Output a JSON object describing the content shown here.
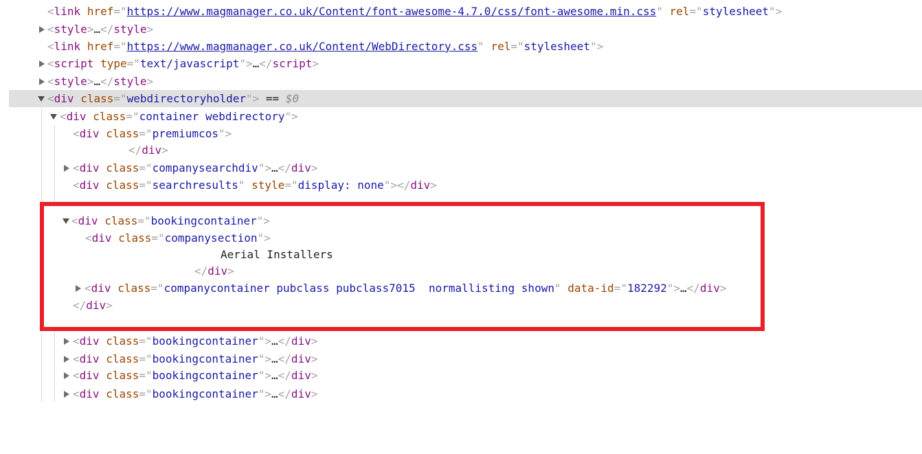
{
  "rows": [
    {
      "parts": [
        [
          "br",
          "<"
        ],
        [
          "tag",
          "link"
        ],
        [
          "txt",
          " "
        ],
        [
          "attr",
          "href"
        ],
        [
          "br",
          "=\""
        ],
        [
          "link",
          "https://www.magmanager.co.uk/Content/font-awesome-4.7.0/css/font-awesome.min.css"
        ],
        [
          "br",
          "\""
        ],
        [
          "txt",
          " "
        ],
        [
          "attr",
          "rel"
        ],
        [
          "br",
          "=\""
        ],
        [
          "val",
          "stylesheet"
        ],
        [
          "br",
          "\">"
        ]
      ]
    },
    {
      "parts": [
        [
          "br",
          "<"
        ],
        [
          "tag",
          "style"
        ],
        [
          "br",
          ">"
        ],
        [
          "ell",
          "…"
        ],
        [
          "br",
          "</"
        ],
        [
          "tag",
          "style"
        ],
        [
          "br",
          ">"
        ]
      ]
    },
    {
      "parts": [
        [
          "br",
          "<"
        ],
        [
          "tag",
          "link"
        ],
        [
          "txt",
          " "
        ],
        [
          "attr",
          "href"
        ],
        [
          "br",
          "=\""
        ],
        [
          "link",
          "https://www.magmanager.co.uk/Content/WebDirectory.css"
        ],
        [
          "br",
          "\""
        ],
        [
          "txt",
          " "
        ],
        [
          "attr",
          "rel"
        ],
        [
          "br",
          "=\""
        ],
        [
          "val",
          "stylesheet"
        ],
        [
          "br",
          "\">"
        ]
      ]
    },
    {
      "parts": [
        [
          "br",
          "<"
        ],
        [
          "tag",
          "script"
        ],
        [
          "txt",
          " "
        ],
        [
          "attr",
          "type"
        ],
        [
          "br",
          "=\""
        ],
        [
          "val",
          "text/javascript"
        ],
        [
          "br",
          "\">"
        ],
        [
          "ell",
          "…"
        ],
        [
          "br",
          "</"
        ],
        [
          "tag",
          "script"
        ],
        [
          "br",
          ">"
        ]
      ]
    },
    {
      "parts": [
        [
          "br",
          "<"
        ],
        [
          "tag",
          "style"
        ],
        [
          "br",
          ">"
        ],
        [
          "ell",
          "…"
        ],
        [
          "br",
          "</"
        ],
        [
          "tag",
          "style"
        ],
        [
          "br",
          ">"
        ]
      ]
    },
    {
      "parts": [
        [
          "br",
          "<"
        ],
        [
          "tag",
          "div"
        ],
        [
          "txt",
          " "
        ],
        [
          "attr",
          "class"
        ],
        [
          "br",
          "=\""
        ],
        [
          "val",
          "webdirectoryholder"
        ],
        [
          "br",
          "\">"
        ],
        [
          "eq",
          " == "
        ],
        [
          "dollar",
          "$0"
        ]
      ]
    },
    {
      "parts": [
        [
          "br",
          "<"
        ],
        [
          "tag",
          "div"
        ],
        [
          "txt",
          " "
        ],
        [
          "attr",
          "class"
        ],
        [
          "br",
          "=\""
        ],
        [
          "val",
          "container webdirectory"
        ],
        [
          "br",
          "\">"
        ]
      ]
    },
    {
      "parts": [
        [
          "br",
          "<"
        ],
        [
          "tag",
          "div"
        ],
        [
          "txt",
          " "
        ],
        [
          "attr",
          "class"
        ],
        [
          "br",
          "=\""
        ],
        [
          "val",
          "premiumcos"
        ],
        [
          "br",
          "\">"
        ]
      ]
    },
    {
      "parts": [
        [
          "br",
          "</"
        ],
        [
          "tag",
          "div"
        ],
        [
          "br",
          ">"
        ]
      ]
    },
    {
      "parts": [
        [
          "br",
          "<"
        ],
        [
          "tag",
          "div"
        ],
        [
          "txt",
          " "
        ],
        [
          "attr",
          "class"
        ],
        [
          "br",
          "=\""
        ],
        [
          "val",
          "companysearchdiv"
        ],
        [
          "br",
          "\">"
        ],
        [
          "ell",
          "…"
        ],
        [
          "br",
          "</"
        ],
        [
          "tag",
          "div"
        ],
        [
          "br",
          ">"
        ]
      ]
    },
    {
      "parts": [
        [
          "br",
          "<"
        ],
        [
          "tag",
          "div"
        ],
        [
          "txt",
          " "
        ],
        [
          "attr",
          "class"
        ],
        [
          "br",
          "=\""
        ],
        [
          "val",
          "searchresults"
        ],
        [
          "br",
          "\""
        ],
        [
          "txt",
          " "
        ],
        [
          "attr",
          "style"
        ],
        [
          "br",
          "=\""
        ],
        [
          "val",
          "display: none"
        ],
        [
          "br",
          "\"></"
        ],
        [
          "tag",
          "div"
        ],
        [
          "br",
          ">"
        ]
      ]
    },
    {
      "parts": [
        [
          "br",
          "<"
        ],
        [
          "tag",
          "div"
        ],
        [
          "txt",
          " "
        ],
        [
          "attr",
          "class"
        ],
        [
          "br",
          "=\""
        ],
        [
          "val",
          "bookingcontainer"
        ],
        [
          "br",
          "\">"
        ]
      ]
    },
    {
      "parts": [
        [
          "br",
          "<"
        ],
        [
          "tag",
          "div"
        ],
        [
          "txt",
          " "
        ],
        [
          "attr",
          "class"
        ],
        [
          "br",
          "=\""
        ],
        [
          "val",
          "companysection"
        ],
        [
          "br",
          "\">"
        ]
      ]
    },
    {
      "parts": [
        [
          "txt",
          "Aerial Installers"
        ]
      ]
    },
    {
      "parts": [
        [
          "br",
          "</"
        ],
        [
          "tag",
          "div"
        ],
        [
          "br",
          ">"
        ]
      ]
    },
    {
      "parts": [
        [
          "br",
          "<"
        ],
        [
          "tag",
          "div"
        ],
        [
          "txt",
          " "
        ],
        [
          "attr",
          "class"
        ],
        [
          "br",
          "=\""
        ],
        [
          "val",
          "companycontainer pubclass pubclass7015  normallisting shown"
        ],
        [
          "br",
          "\""
        ],
        [
          "txt",
          " "
        ],
        [
          "attr",
          "data-id"
        ],
        [
          "br",
          "=\""
        ],
        [
          "val",
          "182292"
        ],
        [
          "br",
          "\">"
        ],
        [
          "ell",
          "…"
        ],
        [
          "br",
          "</"
        ],
        [
          "tag",
          "div"
        ],
        [
          "br",
          ">"
        ]
      ]
    },
    {
      "parts": [
        [
          "br",
          "</"
        ],
        [
          "tag",
          "div"
        ],
        [
          "br",
          ">"
        ]
      ]
    },
    {
      "parts": [
        [
          "br",
          "<"
        ],
        [
          "tag",
          "div"
        ],
        [
          "txt",
          " "
        ],
        [
          "attr",
          "class"
        ],
        [
          "br",
          "=\""
        ],
        [
          "val",
          "bookingcontainer"
        ],
        [
          "br",
          "\">"
        ],
        [
          "ell",
          "…"
        ],
        [
          "br",
          "</"
        ],
        [
          "tag",
          "div"
        ],
        [
          "br",
          ">"
        ]
      ]
    },
    {
      "parts": [
        [
          "br",
          "<"
        ],
        [
          "tag",
          "div"
        ],
        [
          "txt",
          " "
        ],
        [
          "attr",
          "class"
        ],
        [
          "br",
          "=\""
        ],
        [
          "val",
          "bookingcontainer"
        ],
        [
          "br",
          "\">"
        ],
        [
          "ell",
          "…"
        ],
        [
          "br",
          "</"
        ],
        [
          "tag",
          "div"
        ],
        [
          "br",
          ">"
        ]
      ]
    },
    {
      "parts": [
        [
          "br",
          "<"
        ],
        [
          "tag",
          "div"
        ],
        [
          "txt",
          " "
        ],
        [
          "attr",
          "class"
        ],
        [
          "br",
          "=\""
        ],
        [
          "val",
          "bookingcontainer"
        ],
        [
          "br",
          "\">"
        ],
        [
          "ell",
          "…"
        ],
        [
          "br",
          "</"
        ],
        [
          "tag",
          "div"
        ],
        [
          "br",
          ">"
        ]
      ]
    },
    {
      "parts": [
        [
          "br",
          "<"
        ],
        [
          "tag",
          "div"
        ],
        [
          "txt",
          " "
        ],
        [
          "attr",
          "class"
        ],
        [
          "br",
          "=\""
        ],
        [
          "val",
          "bookingcontainer"
        ],
        [
          "br",
          "\">"
        ],
        [
          "ell",
          "…"
        ],
        [
          "br",
          "</"
        ],
        [
          "tag",
          "div"
        ],
        [
          "br",
          ">"
        ]
      ]
    }
  ],
  "colors": {
    "highlight_border": "#e8202a",
    "selected_row": "#e0e0e0",
    "tag": "#881280",
    "attr": "#994500",
    "value": "#1a1aa6"
  },
  "icons": {
    "collapsed": "triangle-right-icon",
    "expanded": "triangle-down-icon"
  }
}
